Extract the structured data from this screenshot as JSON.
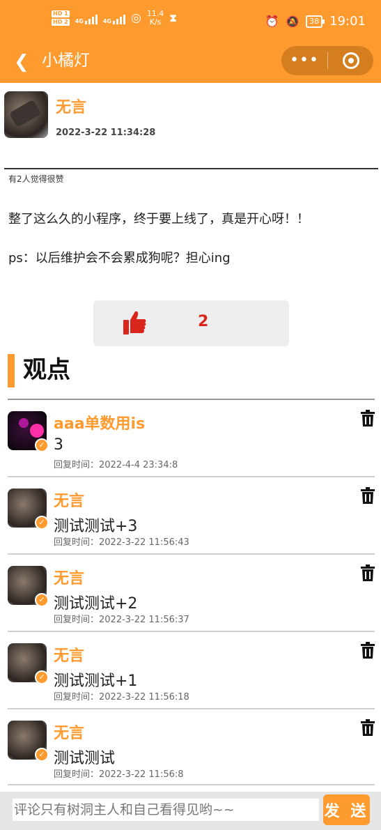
{
  "status_bar": {
    "hd1": "HD 1",
    "hd2": "HD 2",
    "signal1": "4G",
    "signal2": "4G",
    "net_speed_value": "11.4",
    "net_speed_unit": "K/s",
    "battery": "38",
    "time": "19:01"
  },
  "nav": {
    "back_icon": "chevron-left-icon",
    "title": "小橘灯",
    "more_icon": "more-dots-icon",
    "close_icon": "target-circle-icon"
  },
  "post": {
    "author": "无言",
    "time": "2022-3-22 11:34:28",
    "likes_note": "有2人觉得很赞",
    "paragraphs": [
      "整了这么久的小程序，终于要上线了，真是开心呀！！",
      "ps：以后维护会不会累成狗呢？担心ing"
    ],
    "like_count": "2"
  },
  "section": {
    "title": "观点"
  },
  "comments": [
    {
      "name": "aaa单数用is",
      "text": "3",
      "time": "回复时间：2022-4-4 23:34:8"
    },
    {
      "name": "无言",
      "text": "测试测试+3",
      "time": "回复时间：2022-3-22 11:56:43"
    },
    {
      "name": "无言",
      "text": "测试测试+2",
      "time": "回复时间：2022-3-22 11:56:37"
    },
    {
      "name": "无言",
      "text": "测试测试+1",
      "time": "回复时间：2022-3-22 11:56:18"
    },
    {
      "name": "无言",
      "text": "测试测试",
      "time": "回复时间：2022-3-22 11:56:8"
    }
  ],
  "input": {
    "placeholder": "评论只有树洞主人和自己看得见哟~~",
    "send_label": "发 送"
  },
  "colors": {
    "accent": "#ff9a2e",
    "like_red": "#d9261c"
  }
}
